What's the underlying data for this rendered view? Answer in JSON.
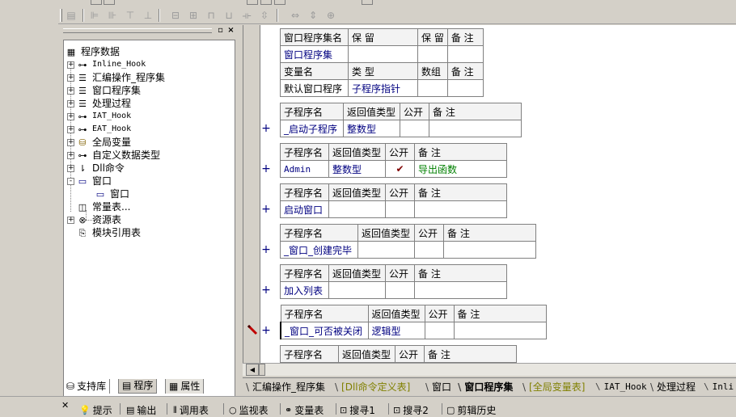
{
  "left_panel": {
    "tree": [
      {
        "label": "程序数据",
        "icon": "database-icon",
        "expander": "",
        "mono": false
      },
      {
        "label": "Inline_Hook",
        "icon": "module-icon",
        "expander": "+",
        "mono": true
      },
      {
        "label": "汇编操作_程序集",
        "icon": "layers-icon",
        "expander": "+",
        "mono": false
      },
      {
        "label": "窗口程序集",
        "icon": "layers-icon",
        "expander": "+",
        "mono": false
      },
      {
        "label": "处理过程",
        "icon": "layers-icon",
        "expander": "+",
        "mono": false
      },
      {
        "label": "IAT_Hook",
        "icon": "module-icon",
        "expander": "+",
        "mono": true
      },
      {
        "label": "EAT_Hook",
        "icon": "module-icon",
        "expander": "+",
        "mono": true
      },
      {
        "label": "全局变量",
        "icon": "cylinder-icon",
        "expander": "+",
        "mono": false
      },
      {
        "label": "自定义数据类型",
        "icon": "module-icon",
        "expander": "+",
        "mono": false
      },
      {
        "label": "Dll命令",
        "icon": "dll-icon",
        "expander": "+",
        "mono": false
      },
      {
        "label": "窗口",
        "icon": "window-icon",
        "expander": "-",
        "mono": false
      },
      {
        "label": "窗口",
        "icon": "window-icon",
        "expander": "",
        "mono": false
      },
      {
        "label": "常量表...",
        "icon": "constant-icon",
        "expander": "",
        "mono": false
      },
      {
        "label": "资源表",
        "icon": "resource-icon",
        "expander": "+",
        "mono": false
      },
      {
        "label": "模块引用表",
        "icon": "module-ref-icon",
        "expander": "",
        "mono": false
      }
    ],
    "tabs": [
      "支持库",
      "程序",
      "属性"
    ]
  },
  "editor": {
    "assembly_header": {
      "headers": [
        "窗口程序集名",
        "保 留",
        "保 留",
        "备 注"
      ],
      "row": [
        "窗口程序集",
        "",
        "",
        ""
      ]
    },
    "var_header": {
      "headers": [
        "变量名",
        "类 型",
        "数组",
        "备 注"
      ],
      "row": [
        "默认窗口程序",
        "子程序指针",
        "",
        ""
      ]
    },
    "sub_headers": [
      "子程序名",
      "返回值类型",
      "公开",
      "备 注"
    ],
    "subs": [
      {
        "name": "_启动子程序",
        "ret": "整数型",
        "pub": "",
        "note": ""
      },
      {
        "name": "Admin",
        "ret": "整数型",
        "pub": "✔",
        "note": "导出函数"
      },
      {
        "name": "启动窗口",
        "ret": "",
        "pub": "",
        "note": ""
      },
      {
        "name": "_窗口_创建完毕",
        "ret": "",
        "pub": "",
        "note": ""
      },
      {
        "name": "加入列表",
        "ret": "",
        "pub": "",
        "note": ""
      },
      {
        "name": "_窗口_可否被关闭",
        "ret": "逻辑型",
        "pub": "",
        "note": ""
      },
      {
        "name": "",
        "ret": "",
        "pub": "",
        "note": ""
      }
    ],
    "expand_mark": "+"
  },
  "editor_tabs": [
    "汇编操作_程序集",
    "[Dll命令定义表]",
    "窗口",
    "窗口程序集",
    "[全局变量表]",
    "IAT_Hook",
    "处理过程",
    "Inli"
  ],
  "dock_tabs": [
    "提示",
    "输出",
    "调用表",
    "监视表",
    "变量表",
    "搜寻1",
    "搜寻2",
    "剪辑历史"
  ],
  "colors": {
    "value_blue": "#000080",
    "green_note": "#008000",
    "checkmark": "#800000"
  }
}
